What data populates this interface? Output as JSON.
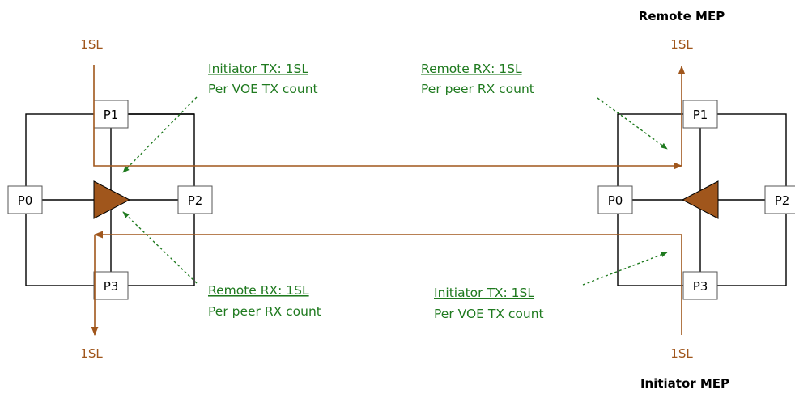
{
  "colors": {
    "flow": "#a0561c",
    "annotation": "#1f7a1f",
    "triangle": "#a0561c"
  },
  "meps": {
    "remote_label": "Remote MEP",
    "initiator_label": "Initiator MEP"
  },
  "ports": {
    "p0": "P0",
    "p1": "P1",
    "p2": "P2",
    "p3": "P3"
  },
  "sl": {
    "left_top": "1SL",
    "left_bottom": "1SL",
    "right_top": "1SL",
    "right_bottom": "1SL"
  },
  "annotations": {
    "left_tx": {
      "title": "Initiator TX: 1SL",
      "detail": "Per VOE TX count"
    },
    "left_rx": {
      "title": "Remote RX: 1SL",
      "detail": "Per peer RX count"
    },
    "right_rx": {
      "title": "Remote RX: 1SL",
      "detail": "Per peer RX count"
    },
    "right_tx": {
      "title": "Initiator TX: 1SL",
      "detail": "Per VOE TX count"
    }
  }
}
